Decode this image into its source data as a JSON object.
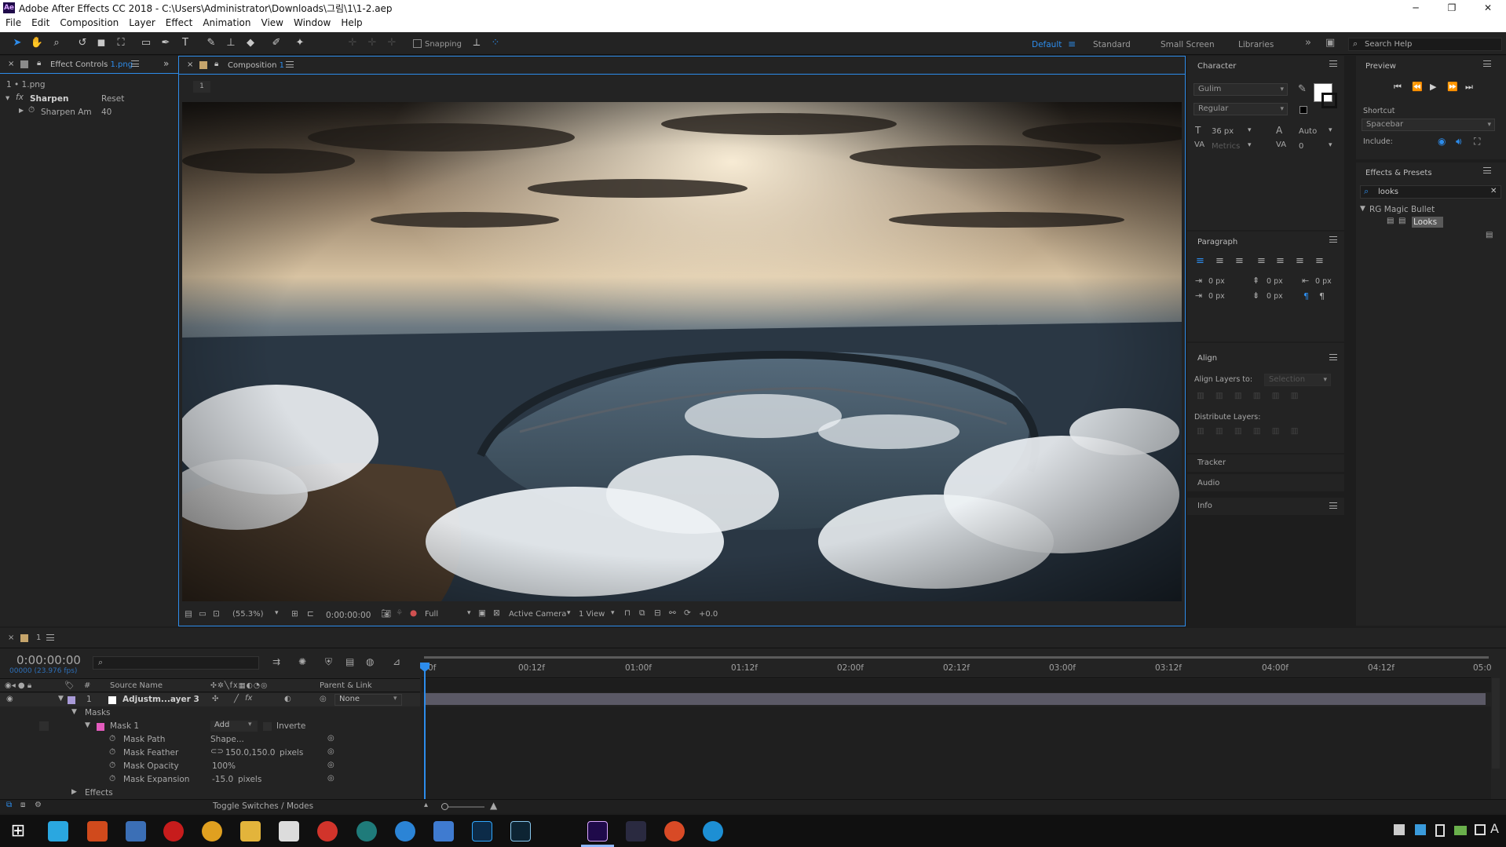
{
  "window": {
    "title": "Adobe After Effects CC 2018 - C:\\Users\\Administrator\\Downloads\\그림\\1\\1-2.aep",
    "app_badge": "Ae"
  },
  "menu": [
    "File",
    "Edit",
    "Composition",
    "Layer",
    "Effect",
    "Animation",
    "View",
    "Window",
    "Help"
  ],
  "toolbar": {
    "snapping_label": "Snapping",
    "workspaces": [
      "Default",
      "Standard",
      "Small Screen",
      "Libraries"
    ],
    "active_workspace": "Default",
    "search_help": "Search Help"
  },
  "effect_controls": {
    "tab_label": "Effect Controls",
    "tab_file": "1.png",
    "layer_path": "1 • 1.png",
    "effect_name": "Sharpen",
    "reset_label": "Reset",
    "property_label": "Sharpen Am",
    "property_value": "40"
  },
  "composition": {
    "tab_label": "Composition",
    "tab_name": "1",
    "flow_tab": "1",
    "zoom": "(55.3%)",
    "timecode": "0:00:00:00",
    "resolution": "Full",
    "camera": "Active Camera",
    "views": "1 View",
    "exposure": "+0.0"
  },
  "character": {
    "title": "Character",
    "font": "Gulim",
    "style": "Regular",
    "size": "36 px",
    "leading": "Auto",
    "kerning": "Metrics",
    "tracking": "0"
  },
  "paragraph": {
    "title": "Paragraph",
    "indent_values": [
      "0 px",
      "0 px",
      "0 px",
      "0 px",
      "0 px"
    ]
  },
  "align": {
    "title": "Align",
    "align_layers_to": "Align Layers to:",
    "selection": "Selection",
    "distribute": "Distribute Layers:"
  },
  "collapsed_panels": [
    "Tracker",
    "Audio",
    "Info"
  ],
  "preview": {
    "title": "Preview",
    "shortcut_label": "Shortcut",
    "shortcut_value": "Spacebar",
    "include_label": "Include:"
  },
  "effects_presets": {
    "title": "Effects & Presets",
    "search_value": "looks",
    "folder": "RG Magic Bullet",
    "item": "Looks"
  },
  "timeline": {
    "tab_name": "1",
    "timecode": "0:00:00:00",
    "fps": "00000 (23.976 fps)",
    "col_num": "#",
    "col_source": "Source Name",
    "col_parent": "Parent & Link",
    "layer_num": "1",
    "layer_name": "Adjustm...ayer 3",
    "parent_value": "None",
    "masks_label": "Masks",
    "mask_name": "Mask 1",
    "mask_mode": "Add",
    "inverted_label": "Inverte",
    "props": [
      {
        "name": "Mask Path",
        "value": "Shape...",
        "unit": ""
      },
      {
        "name": "Mask Feather",
        "value": "150.0,150.0",
        "unit": "pixels"
      },
      {
        "name": "Mask Opacity",
        "value": "100",
        "unit": "%"
      },
      {
        "name": "Mask Expansion",
        "value": "-15.0",
        "unit": "pixels"
      }
    ],
    "effects_label": "Effects",
    "toggle_label": "Toggle Switches / Modes",
    "ruler": [
      "0f",
      "00:12f",
      "01:00f",
      "01:12f",
      "02:00f",
      "02:12f",
      "03:00f",
      "03:12f",
      "04:00f",
      "04:12f",
      "05:0"
    ]
  }
}
